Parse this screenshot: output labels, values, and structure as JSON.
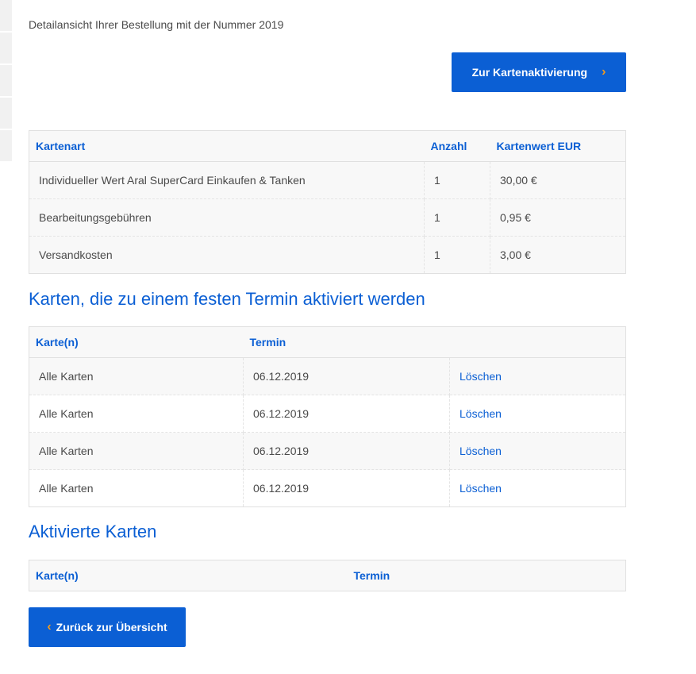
{
  "intro_text": "Detailansicht Ihrer Bestellung mit der Nummer 2019",
  "activation_button": {
    "label": "Zur Kartenaktivierung",
    "icon": "chevron-right-icon"
  },
  "order_table": {
    "headers": [
      "Kartenart",
      "Anzahl",
      "Kartenwert EUR"
    ],
    "rows": [
      [
        "Individueller Wert Aral SuperCard Einkaufen & Tanken",
        "1",
        "30,00 €"
      ],
      [
        "Bearbeitungsgebühren",
        "1",
        "0,95 €"
      ],
      [
        "Versandkosten",
        "1",
        "3,00 €"
      ]
    ]
  },
  "scheduled_section": {
    "title": "Karten, die zu einem festen Termin aktiviert werden",
    "headers": [
      "Karte(n)",
      "Termin",
      ""
    ],
    "rows": [
      [
        "Alle Karten",
        "06.12.2019",
        "Löschen"
      ],
      [
        "Alle Karten",
        "06.12.2019",
        "Löschen"
      ],
      [
        "Alle Karten",
        "06.12.2019",
        "Löschen"
      ],
      [
        "Alle Karten",
        "06.12.2019",
        "Löschen"
      ]
    ]
  },
  "activated_section": {
    "title": "Aktivierte Karten",
    "headers": [
      "Karte(n)",
      "Termin"
    ]
  },
  "back_button": {
    "label": "Zurück zur Übersicht",
    "icon": "chevron-left-icon"
  },
  "colors": {
    "primary": "#0b5fd4",
    "accent": "#f59a1b"
  }
}
